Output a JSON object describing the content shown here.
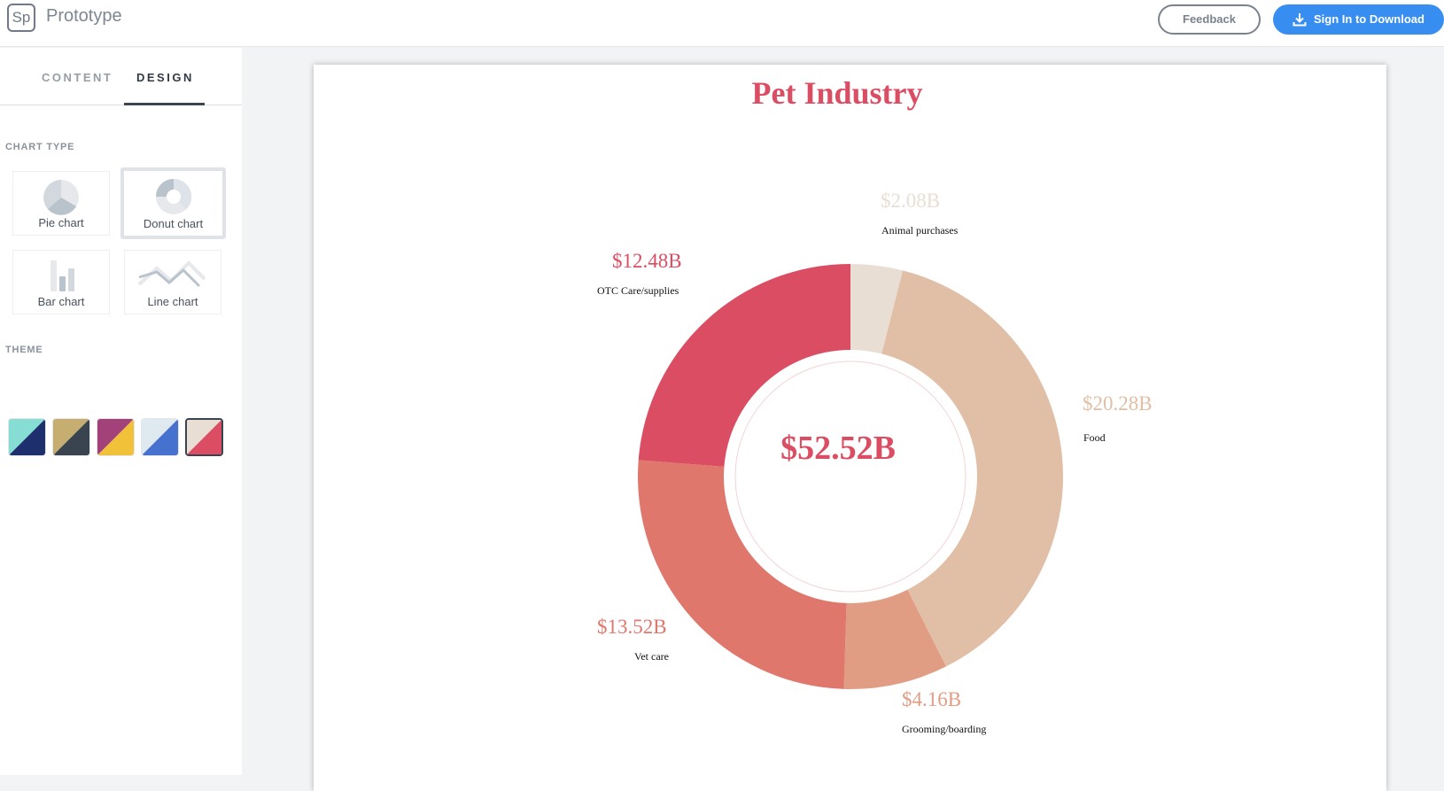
{
  "app": {
    "logo_text": "Sp",
    "title": "Prototype"
  },
  "header": {
    "feedback_label": "Feedback",
    "signin_label": "Sign In to Download"
  },
  "sidebar": {
    "tabs": [
      {
        "label": "CONTENT",
        "active": false
      },
      {
        "label": "DESIGN",
        "active": true
      }
    ],
    "chart_type_heading": "CHART TYPE",
    "chart_types": [
      {
        "label": "Pie chart",
        "icon": "pie-chart-icon",
        "selected": false
      },
      {
        "label": "Donut chart",
        "icon": "donut-chart-icon",
        "selected": true
      },
      {
        "label": "Bar chart",
        "icon": "bar-chart-icon",
        "selected": false
      },
      {
        "label": "Line chart",
        "icon": "line-chart-icon",
        "selected": false
      }
    ],
    "theme_heading": "THEME",
    "themes": [
      {
        "colors": [
          "#86ddd4",
          "#1e2f6e"
        ],
        "selected": false
      },
      {
        "colors": [
          "#c6ad70",
          "#3a4350"
        ],
        "selected": false
      },
      {
        "colors": [
          "#a2417a",
          "#f2c13a"
        ],
        "selected": false
      },
      {
        "colors": [
          "#dfe9f0",
          "#4671cf"
        ],
        "selected": false
      },
      {
        "colors": [
          "#e8ded4",
          "#db4d63"
        ],
        "selected": true
      }
    ]
  },
  "chart_data": {
    "type": "pie",
    "variant": "donut",
    "title": "Pet Industry",
    "center_label": "$52.52B",
    "total": 52.52,
    "unit": "B USD",
    "start_angle": "top",
    "direction": "clockwise",
    "slices": [
      {
        "label": "Animal purchases",
        "value": 2.08,
        "value_label": "$2.08B",
        "color": "#e8ded4"
      },
      {
        "label": "Food",
        "value": 20.28,
        "value_label": "$20.28B",
        "color": "#e1bfa6"
      },
      {
        "label": "Grooming/boarding",
        "value": 4.16,
        "value_label": "$4.16B",
        "color": "#e19c84"
      },
      {
        "label": "Vet care",
        "value": 13.52,
        "value_label": "$13.52B",
        "color": "#df776d"
      },
      {
        "label": "OTC Care/supplies",
        "value": 12.48,
        "value_label": "$12.48B",
        "color": "#db4d63"
      }
    ],
    "title_color": "#db4d63",
    "center_color": "#db4d63"
  }
}
